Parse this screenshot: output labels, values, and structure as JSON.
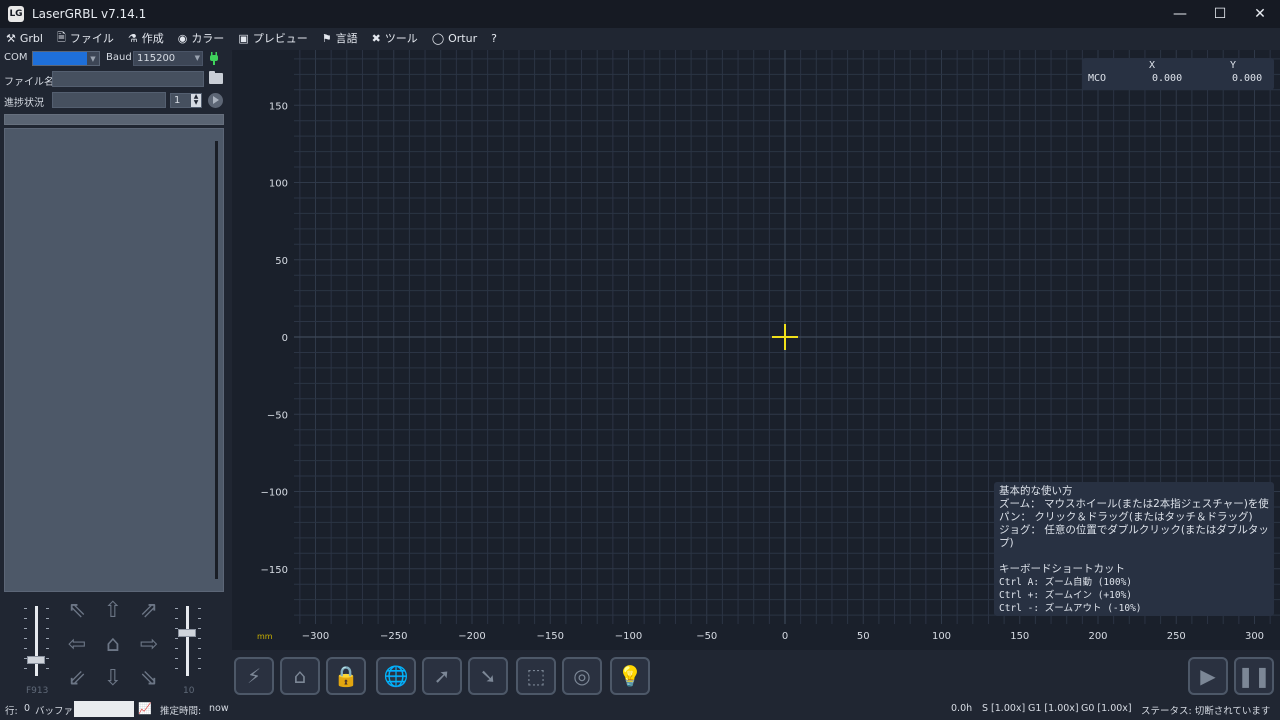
{
  "window": {
    "title": "LaserGRBL v7.14.1",
    "icon_text": "LG",
    "controls": [
      "minimize-icon",
      "maximize-icon",
      "close-icon"
    ]
  },
  "menu": [
    {
      "label": "Grbl",
      "icon": "tools-icon"
    },
    {
      "label": "ファイル",
      "icon": "file-icon"
    },
    {
      "label": "作成",
      "icon": "flask-icon"
    },
    {
      "label": "カラー",
      "icon": "palette-icon"
    },
    {
      "label": "プレビュー",
      "icon": "preview-icon"
    },
    {
      "label": "言語",
      "icon": "flag-icon"
    },
    {
      "label": "ツール",
      "icon": "wrench-icon"
    },
    {
      "label": "Ortur",
      "icon": "ortur-icon"
    },
    {
      "label": "?",
      "icon": ""
    }
  ],
  "connection": {
    "com_label": "COM",
    "com_value": "",
    "baud_label": "Baud",
    "baud_value": "115200",
    "filename_label": "ファイル名",
    "filename_value": "",
    "progress_label": "進捗状況",
    "progress_value": "",
    "passes": "1",
    "progress_bar_text": "",
    "connected_icon": "plug-icon"
  },
  "jog": {
    "speed_label": "F913",
    "step_label": "10",
    "speed_level": 0.2,
    "step_level": 0.55,
    "buttons": [
      "jog-nw",
      "jog-n",
      "jog-ne",
      "jog-w",
      "jog-home",
      "jog-e",
      "jog-sw",
      "jog-s",
      "jog-se"
    ]
  },
  "canvas": {
    "unit_label": "mm",
    "x_ticks": [
      "−300",
      "−250",
      "−200",
      "−150",
      "−100",
      "−50",
      "0",
      "50",
      "100",
      "150",
      "200",
      "250",
      "300"
    ],
    "y_ticks": [
      "150",
      "100",
      "50",
      "0",
      "−50",
      "−100",
      "−150"
    ],
    "grid_color": "#2b3444",
    "axis_color": "#3d4858",
    "cursor_color": "#f0e01a",
    "coords": {
      "mco_label": "MCO",
      "x_label": "X",
      "y_label": "Y",
      "x_value": "0.000",
      "y_value": "0.000"
    },
    "help": {
      "title": "基本的な使い方",
      "lines": [
        "ズーム： マウスホイール(または2本指ジェスチャー)を使",
        "パン： クリック＆ドラッグ(またはタッチ＆ドラッグ)",
        "ジョグ： 任意の位置でダブルクリック(またはダブルタップ)"
      ],
      "shortcuts_title": "キーボードショートカット",
      "shortcuts": [
        "Ctrl A: ズーム自動 (100%)",
        "Ctrl +: ズームイン (+10%)",
        "Ctrl -: ズームアウト (-10%)"
      ]
    }
  },
  "toolbar": {
    "buttons": [
      "reset-icon",
      "home-icon",
      "unlock-icon",
      "globe-icon",
      "laser-on-icon",
      "laser-off-icon",
      "frame-icon",
      "focus-icon",
      "light-icon"
    ],
    "right_buttons": [
      "play-icon",
      "pause-icon"
    ]
  },
  "status": {
    "line_label": "行:",
    "line_value": "0",
    "buffer_label": "バッファー",
    "time_label": "推定時間:",
    "time_value": "now",
    "elapsed": "0.0h",
    "s_override": "S [1.00x]",
    "g1_override": "G1 [1.00x]",
    "g0_override": "G0 [1.00x]",
    "state": "ステータス: 切断されています"
  }
}
